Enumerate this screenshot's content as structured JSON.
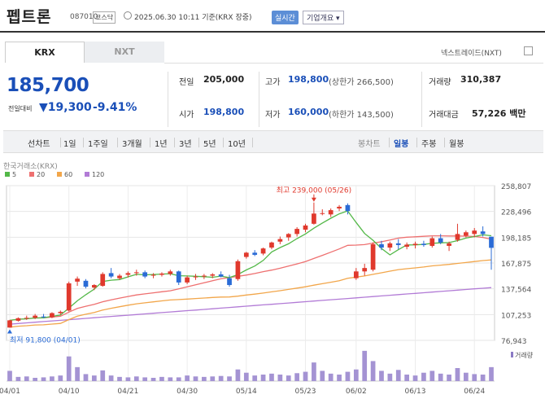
{
  "header": {
    "stock_name": "펩트론",
    "stock_code": "087010",
    "market_badge": "코스닥",
    "timestamp": "2025.06.30 10:11  기준(KRX 장중)",
    "realtime_badge": "실시간",
    "overview_label": "기업개요 ▾"
  },
  "tabs": {
    "krx": "KRX",
    "nxt": "NXT",
    "nxt_link": "넥스트레이드(NXT)"
  },
  "quote": {
    "price": "185,700",
    "change_label": "전일대비",
    "change": "▼19,300",
    "change_pct": "-9.41%",
    "prev_close_label": "전일",
    "prev_close": "205,000",
    "high_label": "고가",
    "high": "198,800",
    "upper_limit": "(상한가 266,500)",
    "volume_label": "거래량",
    "volume": "310,387",
    "open_label": "시가",
    "open": "198,800",
    "low_label": "저가",
    "low": "160,000",
    "lower_limit": "(하한가 143,500)",
    "amount_label": "거래대금",
    "amount": "57,226 백만"
  },
  "toolbar": {
    "line_chart": "선차트",
    "periods": [
      "1일",
      "1주일",
      "3개월",
      "1년",
      "3년",
      "5년",
      "10년"
    ],
    "candle_chart": "봉차트",
    "candle_periods": [
      "일봉",
      "주봉",
      "월봉"
    ],
    "active_candle": "일봉"
  },
  "colors": {
    "up": "#e0392d",
    "down": "#2a6bd6",
    "ma5": "#53b848",
    "ma20": "#ee7070",
    "ma60": "#f2a64a",
    "ma120": "#b27bd6"
  },
  "chart_data": {
    "type": "candlestick",
    "source_label": "한국거래소(KRX)",
    "legend": [
      {
        "name": "5",
        "color": "#53b848"
      },
      {
        "name": "20",
        "color": "#ee7070"
      },
      {
        "name": "60",
        "color": "#f2a64a"
      },
      {
        "name": "120",
        "color": "#b27bd6"
      }
    ],
    "y_ticks": [
      "258,807",
      "228,496",
      "198,185",
      "167,875",
      "137,564",
      "107,253",
      "76,943"
    ],
    "y_tick_values": [
      258807,
      228496,
      198185,
      167875,
      137564,
      107253,
      76943
    ],
    "ylim": [
      76943,
      258807
    ],
    "x_ticks": [
      {
        "i": 0,
        "label": "04/01"
      },
      {
        "i": 7,
        "label": "04/10"
      },
      {
        "i": 14,
        "label": "04/21"
      },
      {
        "i": 21,
        "label": "04/30"
      },
      {
        "i": 28,
        "label": "05/14"
      },
      {
        "i": 35,
        "label": "05/23"
      },
      {
        "i": 41,
        "label": "06/02"
      },
      {
        "i": 48,
        "label": "06/13"
      },
      {
        "i": 55,
        "label": "06/24"
      }
    ],
    "annotations": {
      "high": {
        "i": 36,
        "value": 239000,
        "text": "최고 239,000 (05/26)"
      },
      "low": {
        "i": 0,
        "value": 91800,
        "text": "최저 91,800 (04/01)"
      }
    },
    "volume_label": "거래량",
    "candles": [
      [
        92000,
        101000,
        91800,
        100500
      ],
      [
        100000,
        104000,
        99000,
        103000
      ],
      [
        103000,
        106000,
        101000,
        103500
      ],
      [
        103500,
        108000,
        102000,
        106000
      ],
      [
        105000,
        108000,
        103000,
        104500
      ],
      [
        104000,
        110000,
        103000,
        109000
      ],
      [
        109000,
        112000,
        107000,
        110500
      ],
      [
        112000,
        146000,
        111000,
        144000
      ],
      [
        146000,
        152000,
        141000,
        149500
      ],
      [
        147000,
        149000,
        138000,
        140000
      ],
      [
        139000,
        143000,
        136000,
        142000
      ],
      [
        141000,
        157000,
        140000,
        155000
      ],
      [
        156000,
        162000,
        150000,
        152000
      ],
      [
        150000,
        155000,
        148000,
        153000
      ],
      [
        154000,
        158000,
        151000,
        156000
      ],
      [
        156000,
        160000,
        153000,
        157000
      ],
      [
        157000,
        159000,
        150000,
        152000
      ],
      [
        153000,
        156000,
        150000,
        154000
      ],
      [
        154000,
        157000,
        152000,
        155500
      ],
      [
        155000,
        160000,
        153000,
        158000
      ],
      [
        158000,
        159000,
        142000,
        145000
      ],
      [
        145000,
        153000,
        143000,
        151000
      ],
      [
        151000,
        155000,
        148000,
        152000
      ],
      [
        152000,
        155000,
        149000,
        153000
      ],
      [
        153000,
        156000,
        150000,
        154500
      ],
      [
        154500,
        158000,
        151000,
        152000
      ],
      [
        150000,
        154000,
        140000,
        142000
      ],
      [
        149000,
        172000,
        147000,
        170000
      ],
      [
        175000,
        181000,
        173000,
        180000
      ],
      [
        180000,
        183000,
        176000,
        177500
      ],
      [
        179000,
        186000,
        177000,
        185000
      ],
      [
        186000,
        193000,
        184000,
        192000
      ],
      [
        193000,
        199000,
        190000,
        196000
      ],
      [
        198000,
        203000,
        194000,
        202000
      ],
      [
        202000,
        210000,
        199000,
        208000
      ],
      [
        207000,
        214000,
        204000,
        212000
      ],
      [
        214000,
        239000,
        213000,
        226000
      ],
      [
        226000,
        231000,
        224000,
        226500
      ],
      [
        225000,
        232000,
        222000,
        230000
      ],
      [
        232000,
        236000,
        229000,
        234000
      ],
      [
        236000,
        238000,
        225000,
        229000
      ],
      [
        150000,
        162000,
        148000,
        158000
      ],
      [
        158000,
        167000,
        153000,
        162000
      ],
      [
        160000,
        192000,
        158000,
        190000
      ],
      [
        190000,
        194000,
        183000,
        186000
      ],
      [
        186000,
        193000,
        182000,
        191000
      ],
      [
        191000,
        196000,
        184000,
        189000
      ],
      [
        187000,
        192000,
        184000,
        189500
      ],
      [
        189000,
        193000,
        185000,
        190500
      ],
      [
        190500,
        194000,
        187000,
        189000
      ],
      [
        188000,
        199000,
        186000,
        197000
      ],
      [
        197000,
        202000,
        190000,
        192000
      ],
      [
        188000,
        193000,
        182000,
        191000
      ],
      [
        195000,
        214000,
        193000,
        202000
      ],
      [
        200000,
        206000,
        198000,
        204000
      ],
      [
        202000,
        209000,
        198000,
        206000
      ],
      [
        205000,
        211000,
        199000,
        202000
      ],
      [
        198800,
        198800,
        160000,
        185700
      ]
    ],
    "volumes": [
      22,
      9,
      10,
      7,
      8,
      10,
      12,
      53,
      30,
      15,
      12,
      23,
      12,
      9,
      8,
      10,
      8,
      7,
      9,
      8,
      8,
      12,
      10,
      9,
      10,
      11,
      10,
      25,
      18,
      12,
      14,
      16,
      14,
      12,
      17,
      20,
      40,
      22,
      16,
      14,
      20,
      25,
      65,
      43,
      22,
      16,
      24,
      14,
      12,
      18,
      22,
      16,
      14,
      28,
      18,
      15,
      14,
      30
    ]
  }
}
